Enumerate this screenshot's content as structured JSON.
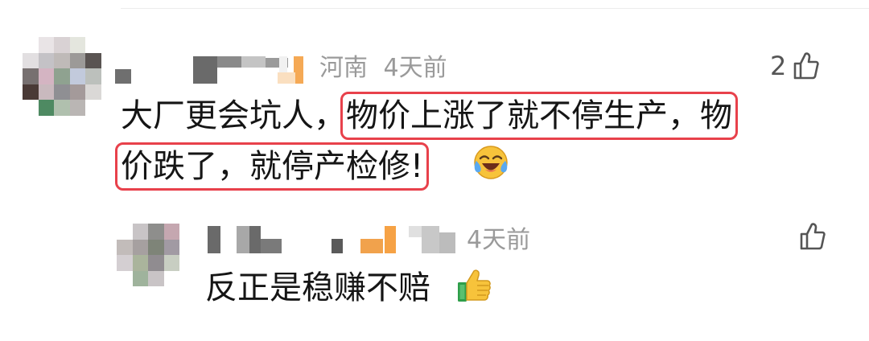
{
  "comment": {
    "location": "河南",
    "time": "4天前",
    "like_count": "2",
    "text_plain_1": "大厂更会坑人，",
    "text_highlight_1": "物价上涨了就不停生产，物",
    "text_highlight_2": "价跌了，就停产检修!",
    "emoji": "laughing-tears-emoji"
  },
  "reply": {
    "time": "4天前",
    "text": "反正是稳赚不赔",
    "emoji": "thumbs-up-emoji"
  },
  "colors": {
    "highlight_border": "#e8414b",
    "meta_text": "#9a9a9a",
    "body_text": "#151515"
  }
}
